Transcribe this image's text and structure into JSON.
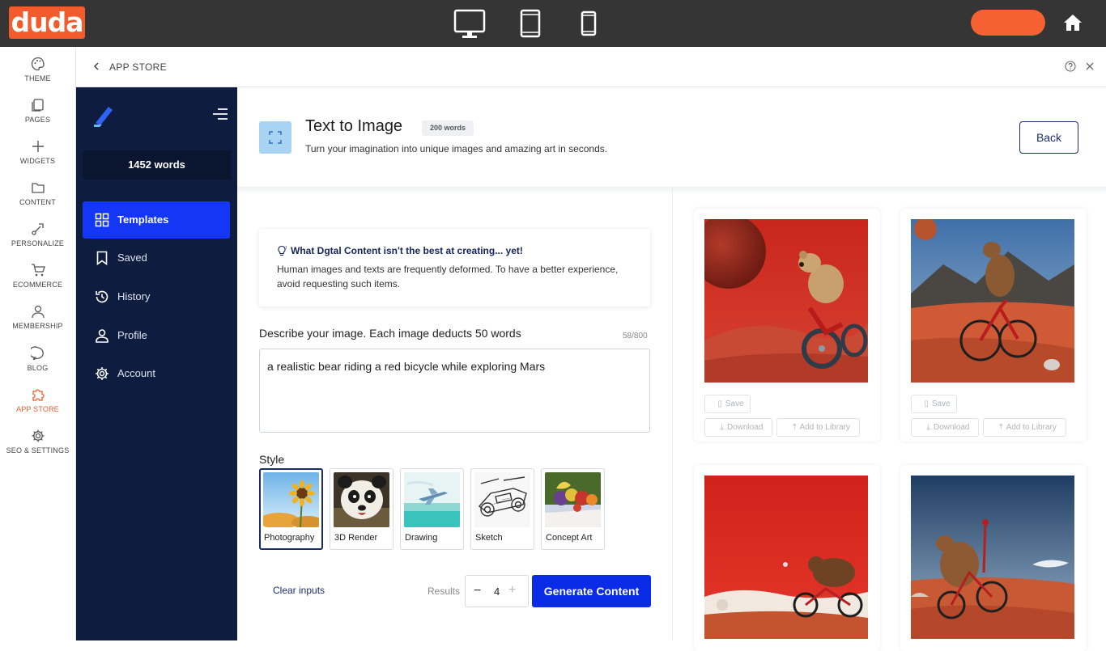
{
  "app": {
    "logo_text": "duda",
    "brand_color": "#f25b2b"
  },
  "topbar": {
    "devices": [
      "desktop-icon",
      "tablet-icon",
      "mobile-icon"
    ],
    "home_icon": "home-icon"
  },
  "rail": {
    "items": [
      {
        "label": "THEME",
        "icon": "palette-icon"
      },
      {
        "label": "PAGES",
        "icon": "pages-icon"
      },
      {
        "label": "WIDGETS",
        "icon": "plus-icon"
      },
      {
        "label": "CONTENT",
        "icon": "folder-icon"
      },
      {
        "label": "PERSONALIZE",
        "icon": "personalize-icon"
      },
      {
        "label": "ECOMMERCE",
        "icon": "cart-icon"
      },
      {
        "label": "MEMBERSHIP",
        "icon": "user-icon"
      },
      {
        "label": "BLOG",
        "icon": "chat-icon"
      },
      {
        "label": "APP STORE",
        "icon": "puzzle-icon",
        "active": true
      },
      {
        "label": "SEO & SETTINGS",
        "icon": "gear-icon"
      }
    ]
  },
  "header": {
    "title": "APP STORE"
  },
  "sidebar": {
    "word_count": "1452 words",
    "items": [
      {
        "label": "Templates",
        "icon": "grid-icon",
        "active": true
      },
      {
        "label": "Saved",
        "icon": "bookmark-icon"
      },
      {
        "label": "History",
        "icon": "history-icon"
      },
      {
        "label": "Profile",
        "icon": "user-icon"
      },
      {
        "label": "Account",
        "icon": "gear-icon"
      }
    ]
  },
  "main": {
    "title": "Text to Image",
    "badge": "200 words",
    "subtitle": "Turn your imagination into unique images and amazing art in seconds.",
    "back_label": "Back",
    "warning": {
      "title": "What Dgtal Content isn't the best at creating... yet!",
      "body": "Human images and texts are frequently deformed. To have a better experience, avoid requesting such items."
    },
    "describe_label": "Describe your image. Each image deducts 50 words",
    "char_counter": "58/800",
    "prompt_value": "a realistic bear riding a red bicycle while exploring Mars",
    "style_label": "Style",
    "styles": [
      {
        "label": "Photography",
        "selected": true
      },
      {
        "label": "3D Render"
      },
      {
        "label": "Drawing"
      },
      {
        "label": "Sketch"
      },
      {
        "label": "Concept Art"
      }
    ],
    "clear_label": "Clear inputs",
    "results_label": "Results",
    "results_value": "4",
    "generate_label": "Generate Content",
    "accent_color": "#0a2ce6"
  },
  "results": {
    "save_label": "Save",
    "download_label": "Download",
    "add_library_label": "Add to Library"
  }
}
